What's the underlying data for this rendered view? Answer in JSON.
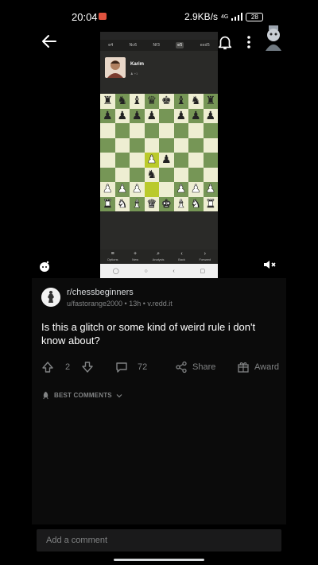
{
  "status_bar": {
    "time": "20:04",
    "net_speed": "2.9KB/s",
    "signal": "4G",
    "battery": "28"
  },
  "video": {
    "phone_tabs": [
      "e4",
      "Nc6",
      "Nf3",
      "e5",
      "exd5"
    ],
    "player_name": "Karim",
    "player_sub": "♟ +1",
    "board": [
      [
        "r",
        "n",
        "b",
        "q",
        "k",
        "b",
        "n",
        "r"
      ],
      [
        "p",
        "p",
        "p",
        "p",
        "",
        "p",
        "p",
        "p"
      ],
      [
        "",
        "",
        "",
        "",
        "",
        "",
        "",
        ""
      ],
      [
        "",
        "",
        "",
        "",
        "",
        "",
        "",
        ""
      ],
      [
        "",
        "",
        "",
        "P",
        "p",
        "",
        "",
        ""
      ],
      [
        "",
        "",
        "",
        "n",
        "",
        "",
        "",
        ""
      ],
      [
        "P",
        "P",
        "P",
        "",
        "",
        "P",
        "P",
        "P"
      ],
      [
        "R",
        "N",
        "B",
        "Q",
        "K",
        "B",
        "N",
        "R"
      ]
    ],
    "bottom_buttons": [
      "Options",
      "New",
      "Analysis",
      "Back",
      "Forward"
    ],
    "bottom_icons": [
      "≡",
      "+",
      "⌕",
      "‹",
      "›"
    ]
  },
  "post": {
    "subreddit": "r/chessbeginners",
    "meta": "u/fastorange2000 • 13h • v.redd.it",
    "title": "Is this a glitch or some kind of weird rule i don't know about?",
    "upvotes": "2",
    "comments": "72",
    "share_label": "Share",
    "award_label": "Award"
  },
  "comments_sort": "BEST COMMENTS",
  "comment_placeholder": "Add a comment",
  "colors": {
    "background": "#000000",
    "card": "#0b0b0b",
    "muted_text": "#818384",
    "board_light": "#eeeed2",
    "board_dark": "#769656",
    "highlight": "#baca2b"
  }
}
